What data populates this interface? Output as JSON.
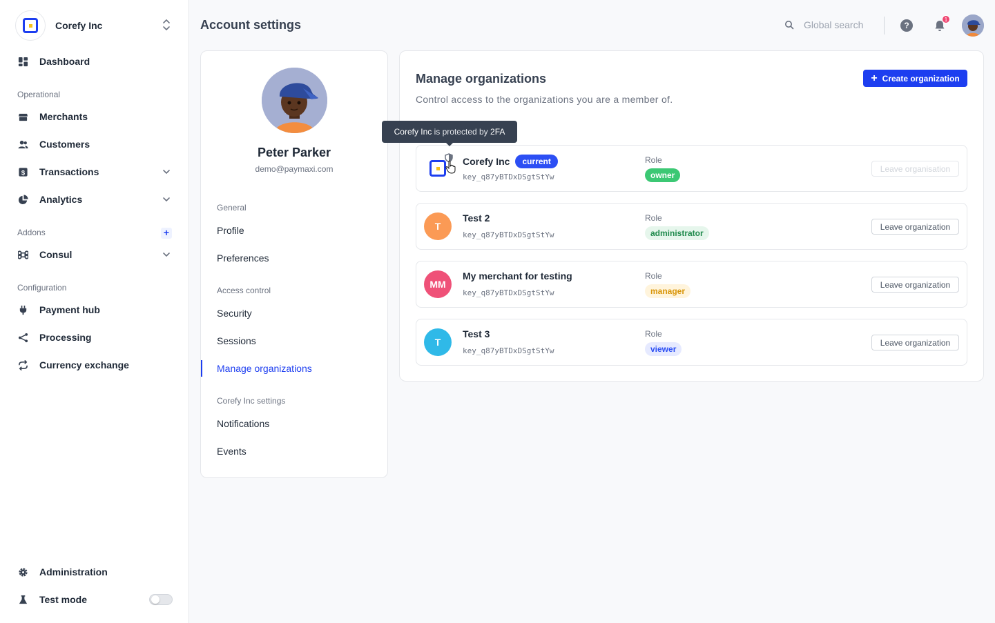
{
  "sidebar": {
    "org_name": "Corefy Inc",
    "items": {
      "dashboard": "Dashboard",
      "merchants": "Merchants",
      "customers": "Customers",
      "transactions": "Transactions",
      "analytics": "Analytics",
      "consul": "Consul",
      "payment_hub": "Payment hub",
      "processing": "Processing",
      "currency_exchange": "Currency exchange",
      "administration": "Administration",
      "test_mode": "Test mode"
    },
    "sections": {
      "operational": "Operational",
      "addons": "Addons",
      "configuration": "Configuration"
    },
    "test_mode_enabled": false
  },
  "header": {
    "title": "Account settings",
    "search_placeholder": "Global search",
    "help_glyph": "?",
    "notification_count": "1"
  },
  "profile": {
    "name": "Peter Parker",
    "email": "demo@paymaxi.com",
    "menu": {
      "general": "General",
      "profile": "Profile",
      "preferences": "Preferences",
      "access_control": "Access control",
      "security": "Security",
      "sessions": "Sessions",
      "manage_organizations": "Manage organizations",
      "org_settings": "Corefy Inc settings",
      "notifications": "Notifications",
      "events": "Events"
    }
  },
  "orgs": {
    "title": "Manage organizations",
    "subtitle": "Control access to the organizations you are a member of.",
    "create_label": "Create organization",
    "role_label": "Role",
    "leave_label": "Leave organisation",
    "leave_label_alt": "Leave organization",
    "current_label": "current",
    "tooltip": {
      "org": "Corefy Inc",
      "mid": " is protected by ",
      "method": "2FA"
    },
    "rows": [
      {
        "name": "Corefy Inc",
        "initials": "",
        "key": "key_q87yBTDxDSgtStYw",
        "role": "owner",
        "avatar_color": "#ffffff"
      },
      {
        "name": "Test 2",
        "initials": "T",
        "key": "key_q87yBTDxDSgtStYw",
        "role": "administrator",
        "avatar_color": "#fb9a55"
      },
      {
        "name": "My merchant for testing",
        "initials": "MM",
        "key": "key_q87yBTDxDSgtStYw",
        "role": "manager",
        "avatar_color": "#ef5178"
      },
      {
        "name": "Test 3",
        "initials": "T",
        "key": "key_q87yBTDxDSgtStYw",
        "role": "viewer",
        "avatar_color": "#2fb9e8"
      }
    ]
  },
  "colors": {
    "accent": "#1d3ef0",
    "role_owner": "#3cc874",
    "role_administrator_bg": "#e6f6ec",
    "role_manager_bg": "#fff4dc",
    "role_viewer_bg": "#e6eaff"
  }
}
